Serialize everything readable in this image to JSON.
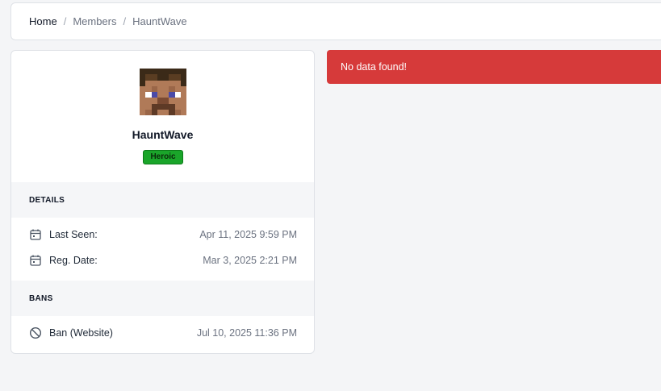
{
  "breadcrumb": {
    "home": "Home",
    "members": "Members",
    "current": "HauntWave",
    "separator": "/"
  },
  "profile": {
    "username": "HauntWave",
    "rank": "Heroic",
    "rank_color": "#1aa52a"
  },
  "details": {
    "heading": "DETAILS",
    "last_seen_label": "Last Seen:",
    "last_seen_value": "Apr 11, 2025 9:59 PM",
    "reg_date_label": "Reg. Date:",
    "reg_date_value": "Mar 3, 2025 2:21 PM"
  },
  "bans": {
    "heading": "BANS",
    "items": [
      {
        "label": "Ban (Website)",
        "date": "Jul 10, 2025 11:36 PM"
      }
    ]
  },
  "alert": {
    "message": "No data found!",
    "color": "#d63a3a"
  },
  "icons": {
    "calendar": "calendar-icon",
    "ban": "ban-icon"
  }
}
